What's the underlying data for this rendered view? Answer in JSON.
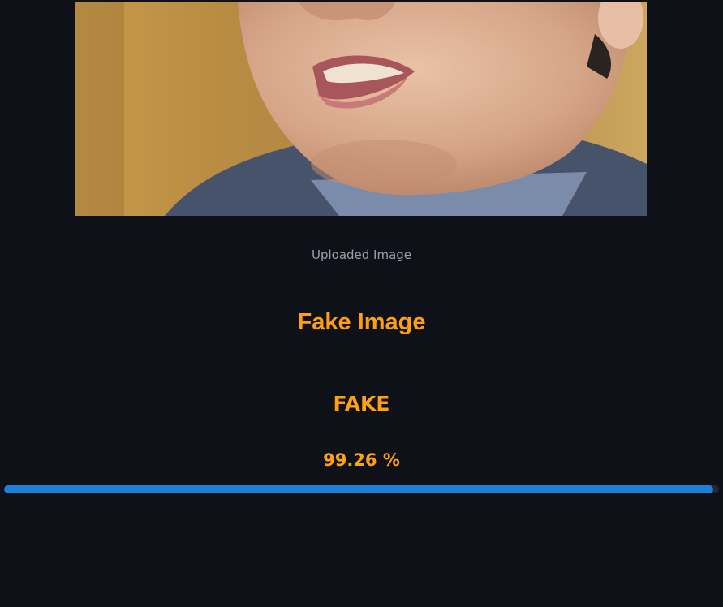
{
  "image": {
    "caption": "Uploaded Image"
  },
  "result": {
    "heading": "Fake Image",
    "label": "FAKE",
    "confidence_text": "99.26 %",
    "confidence_fraction": 0.9926
  },
  "colors": {
    "background": "#0e1117",
    "accent_text": "#ffa010",
    "progress_fill": "#1e7fdb",
    "progress_track": "#262730",
    "caption_text": "#9a9ea6"
  }
}
